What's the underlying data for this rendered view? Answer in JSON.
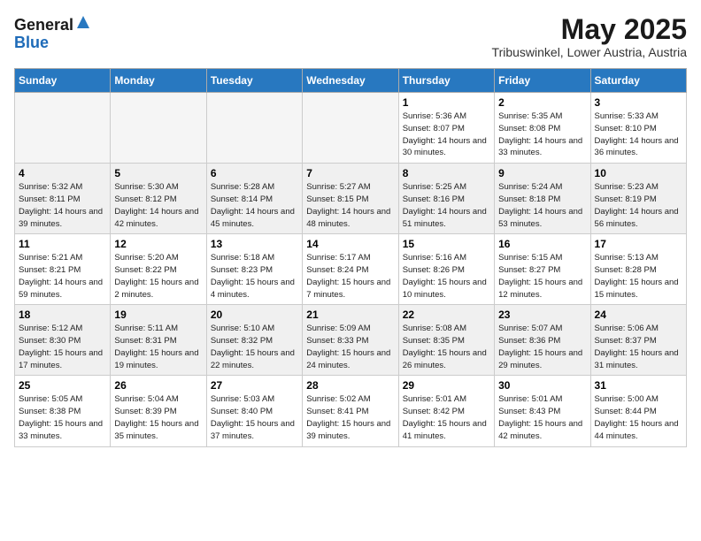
{
  "header": {
    "logo_general": "General",
    "logo_blue": "Blue",
    "month": "May 2025",
    "location": "Tribuswinkel, Lower Austria, Austria"
  },
  "days_of_week": [
    "Sunday",
    "Monday",
    "Tuesday",
    "Wednesday",
    "Thursday",
    "Friday",
    "Saturday"
  ],
  "weeks": [
    [
      {
        "day": "",
        "empty": true
      },
      {
        "day": "",
        "empty": true
      },
      {
        "day": "",
        "empty": true
      },
      {
        "day": "",
        "empty": true
      },
      {
        "day": "1",
        "sunrise": "5:36 AM",
        "sunset": "8:07 PM",
        "daylight": "14 hours and 30 minutes."
      },
      {
        "day": "2",
        "sunrise": "5:35 AM",
        "sunset": "8:08 PM",
        "daylight": "14 hours and 33 minutes."
      },
      {
        "day": "3",
        "sunrise": "5:33 AM",
        "sunset": "8:10 PM",
        "daylight": "14 hours and 36 minutes."
      }
    ],
    [
      {
        "day": "4",
        "sunrise": "5:32 AM",
        "sunset": "8:11 PM",
        "daylight": "14 hours and 39 minutes."
      },
      {
        "day": "5",
        "sunrise": "5:30 AM",
        "sunset": "8:12 PM",
        "daylight": "14 hours and 42 minutes."
      },
      {
        "day": "6",
        "sunrise": "5:28 AM",
        "sunset": "8:14 PM",
        "daylight": "14 hours and 45 minutes."
      },
      {
        "day": "7",
        "sunrise": "5:27 AM",
        "sunset": "8:15 PM",
        "daylight": "14 hours and 48 minutes."
      },
      {
        "day": "8",
        "sunrise": "5:25 AM",
        "sunset": "8:16 PM",
        "daylight": "14 hours and 51 minutes."
      },
      {
        "day": "9",
        "sunrise": "5:24 AM",
        "sunset": "8:18 PM",
        "daylight": "14 hours and 53 minutes."
      },
      {
        "day": "10",
        "sunrise": "5:23 AM",
        "sunset": "8:19 PM",
        "daylight": "14 hours and 56 minutes."
      }
    ],
    [
      {
        "day": "11",
        "sunrise": "5:21 AM",
        "sunset": "8:21 PM",
        "daylight": "14 hours and 59 minutes."
      },
      {
        "day": "12",
        "sunrise": "5:20 AM",
        "sunset": "8:22 PM",
        "daylight": "15 hours and 2 minutes."
      },
      {
        "day": "13",
        "sunrise": "5:18 AM",
        "sunset": "8:23 PM",
        "daylight": "15 hours and 4 minutes."
      },
      {
        "day": "14",
        "sunrise": "5:17 AM",
        "sunset": "8:24 PM",
        "daylight": "15 hours and 7 minutes."
      },
      {
        "day": "15",
        "sunrise": "5:16 AM",
        "sunset": "8:26 PM",
        "daylight": "15 hours and 10 minutes."
      },
      {
        "day": "16",
        "sunrise": "5:15 AM",
        "sunset": "8:27 PM",
        "daylight": "15 hours and 12 minutes."
      },
      {
        "day": "17",
        "sunrise": "5:13 AM",
        "sunset": "8:28 PM",
        "daylight": "15 hours and 15 minutes."
      }
    ],
    [
      {
        "day": "18",
        "sunrise": "5:12 AM",
        "sunset": "8:30 PM",
        "daylight": "15 hours and 17 minutes."
      },
      {
        "day": "19",
        "sunrise": "5:11 AM",
        "sunset": "8:31 PM",
        "daylight": "15 hours and 19 minutes."
      },
      {
        "day": "20",
        "sunrise": "5:10 AM",
        "sunset": "8:32 PM",
        "daylight": "15 hours and 22 minutes."
      },
      {
        "day": "21",
        "sunrise": "5:09 AM",
        "sunset": "8:33 PM",
        "daylight": "15 hours and 24 minutes."
      },
      {
        "day": "22",
        "sunrise": "5:08 AM",
        "sunset": "8:35 PM",
        "daylight": "15 hours and 26 minutes."
      },
      {
        "day": "23",
        "sunrise": "5:07 AM",
        "sunset": "8:36 PM",
        "daylight": "15 hours and 29 minutes."
      },
      {
        "day": "24",
        "sunrise": "5:06 AM",
        "sunset": "8:37 PM",
        "daylight": "15 hours and 31 minutes."
      }
    ],
    [
      {
        "day": "25",
        "sunrise": "5:05 AM",
        "sunset": "8:38 PM",
        "daylight": "15 hours and 33 minutes."
      },
      {
        "day": "26",
        "sunrise": "5:04 AM",
        "sunset": "8:39 PM",
        "daylight": "15 hours and 35 minutes."
      },
      {
        "day": "27",
        "sunrise": "5:03 AM",
        "sunset": "8:40 PM",
        "daylight": "15 hours and 37 minutes."
      },
      {
        "day": "28",
        "sunrise": "5:02 AM",
        "sunset": "8:41 PM",
        "daylight": "15 hours and 39 minutes."
      },
      {
        "day": "29",
        "sunrise": "5:01 AM",
        "sunset": "8:42 PM",
        "daylight": "15 hours and 41 minutes."
      },
      {
        "day": "30",
        "sunrise": "5:01 AM",
        "sunset": "8:43 PM",
        "daylight": "15 hours and 42 minutes."
      },
      {
        "day": "31",
        "sunrise": "5:00 AM",
        "sunset": "8:44 PM",
        "daylight": "15 hours and 44 minutes."
      }
    ]
  ]
}
